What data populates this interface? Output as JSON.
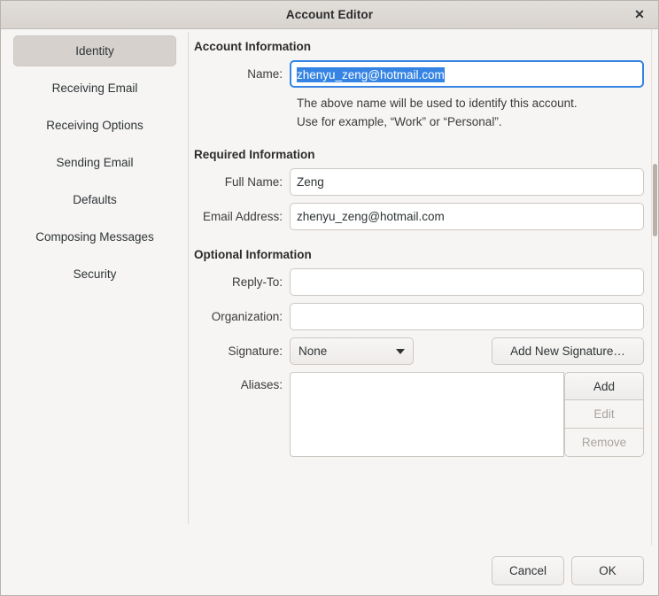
{
  "window": {
    "title": "Account Editor",
    "close_icon": "close-icon"
  },
  "sidebar": {
    "items": [
      {
        "label": "Identity",
        "selected": true
      },
      {
        "label": "Receiving Email",
        "selected": false
      },
      {
        "label": "Receiving Options",
        "selected": false
      },
      {
        "label": "Sending Email",
        "selected": false
      },
      {
        "label": "Defaults",
        "selected": false
      },
      {
        "label": "Composing Messages",
        "selected": false
      },
      {
        "label": "Security",
        "selected": false
      }
    ]
  },
  "account_information": {
    "heading": "Account Information",
    "name_label": "Name:",
    "name_value": "zhenyu_zeng@hotmail.com",
    "help_line1": "The above name will be used to identify this account.",
    "help_line2": "Use for example, “Work” or “Personal”."
  },
  "required_information": {
    "heading": "Required Information",
    "full_name_label": "Full Name:",
    "full_name_value": "Zeng",
    "email_label": "Email Address:",
    "email_value": "zhenyu_zeng@hotmail.com"
  },
  "optional_information": {
    "heading": "Optional Information",
    "reply_to_label": "Reply-To:",
    "reply_to_value": "",
    "organization_label": "Organization:",
    "organization_value": "",
    "signature_label": "Signature:",
    "signature_value": "None",
    "signature_caret_icon": "chevron-down-icon",
    "add_signature_label": "Add New Signature…",
    "aliases_label": "Aliases:",
    "aliases_items": [],
    "alias_add_label": "Add",
    "alias_edit_label": "Edit",
    "alias_remove_label": "Remove"
  },
  "footer": {
    "cancel_label": "Cancel",
    "ok_label": "OK"
  },
  "colors": {
    "accent": "#3584e4",
    "window_bg": "#f6f5f4",
    "titlebar_bg": "#dcd8d3",
    "selected_item_bg": "#d6d1cd"
  }
}
